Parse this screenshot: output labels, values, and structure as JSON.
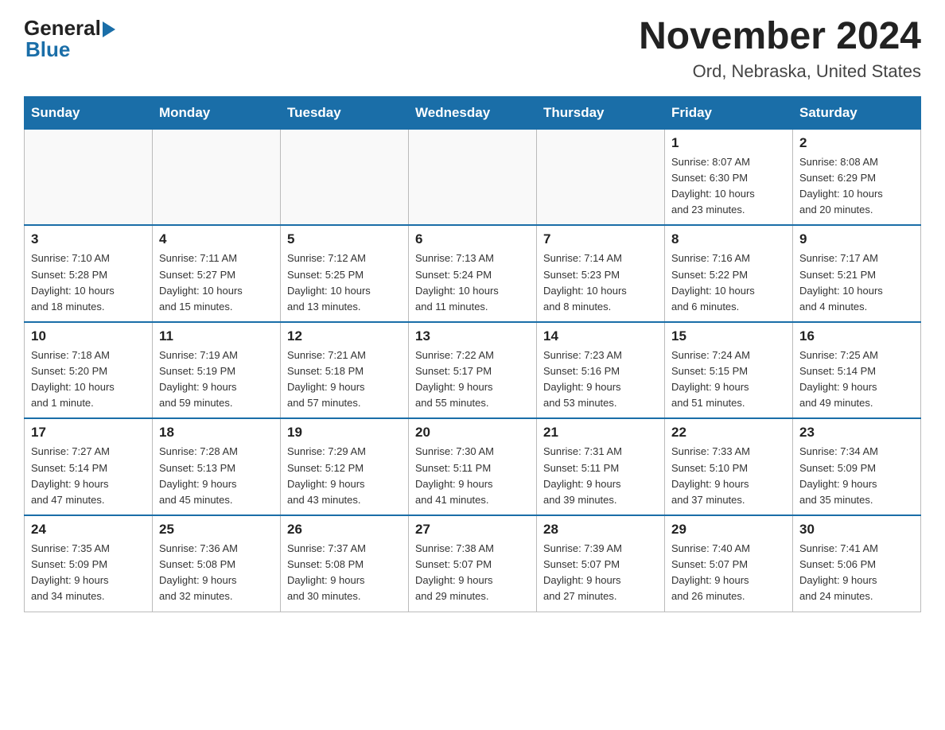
{
  "header": {
    "logo_general": "General",
    "logo_blue": "Blue",
    "month": "November 2024",
    "location": "Ord, Nebraska, United States"
  },
  "weekdays": [
    "Sunday",
    "Monday",
    "Tuesday",
    "Wednesday",
    "Thursday",
    "Friday",
    "Saturday"
  ],
  "weeks": [
    {
      "days": [
        {
          "num": "",
          "info": ""
        },
        {
          "num": "",
          "info": ""
        },
        {
          "num": "",
          "info": ""
        },
        {
          "num": "",
          "info": ""
        },
        {
          "num": "",
          "info": ""
        },
        {
          "num": "1",
          "info": "Sunrise: 8:07 AM\nSunset: 6:30 PM\nDaylight: 10 hours\nand 23 minutes."
        },
        {
          "num": "2",
          "info": "Sunrise: 8:08 AM\nSunset: 6:29 PM\nDaylight: 10 hours\nand 20 minutes."
        }
      ]
    },
    {
      "days": [
        {
          "num": "3",
          "info": "Sunrise: 7:10 AM\nSunset: 5:28 PM\nDaylight: 10 hours\nand 18 minutes."
        },
        {
          "num": "4",
          "info": "Sunrise: 7:11 AM\nSunset: 5:27 PM\nDaylight: 10 hours\nand 15 minutes."
        },
        {
          "num": "5",
          "info": "Sunrise: 7:12 AM\nSunset: 5:25 PM\nDaylight: 10 hours\nand 13 minutes."
        },
        {
          "num": "6",
          "info": "Sunrise: 7:13 AM\nSunset: 5:24 PM\nDaylight: 10 hours\nand 11 minutes."
        },
        {
          "num": "7",
          "info": "Sunrise: 7:14 AM\nSunset: 5:23 PM\nDaylight: 10 hours\nand 8 minutes."
        },
        {
          "num": "8",
          "info": "Sunrise: 7:16 AM\nSunset: 5:22 PM\nDaylight: 10 hours\nand 6 minutes."
        },
        {
          "num": "9",
          "info": "Sunrise: 7:17 AM\nSunset: 5:21 PM\nDaylight: 10 hours\nand 4 minutes."
        }
      ]
    },
    {
      "days": [
        {
          "num": "10",
          "info": "Sunrise: 7:18 AM\nSunset: 5:20 PM\nDaylight: 10 hours\nand 1 minute."
        },
        {
          "num": "11",
          "info": "Sunrise: 7:19 AM\nSunset: 5:19 PM\nDaylight: 9 hours\nand 59 minutes."
        },
        {
          "num": "12",
          "info": "Sunrise: 7:21 AM\nSunset: 5:18 PM\nDaylight: 9 hours\nand 57 minutes."
        },
        {
          "num": "13",
          "info": "Sunrise: 7:22 AM\nSunset: 5:17 PM\nDaylight: 9 hours\nand 55 minutes."
        },
        {
          "num": "14",
          "info": "Sunrise: 7:23 AM\nSunset: 5:16 PM\nDaylight: 9 hours\nand 53 minutes."
        },
        {
          "num": "15",
          "info": "Sunrise: 7:24 AM\nSunset: 5:15 PM\nDaylight: 9 hours\nand 51 minutes."
        },
        {
          "num": "16",
          "info": "Sunrise: 7:25 AM\nSunset: 5:14 PM\nDaylight: 9 hours\nand 49 minutes."
        }
      ]
    },
    {
      "days": [
        {
          "num": "17",
          "info": "Sunrise: 7:27 AM\nSunset: 5:14 PM\nDaylight: 9 hours\nand 47 minutes."
        },
        {
          "num": "18",
          "info": "Sunrise: 7:28 AM\nSunset: 5:13 PM\nDaylight: 9 hours\nand 45 minutes."
        },
        {
          "num": "19",
          "info": "Sunrise: 7:29 AM\nSunset: 5:12 PM\nDaylight: 9 hours\nand 43 minutes."
        },
        {
          "num": "20",
          "info": "Sunrise: 7:30 AM\nSunset: 5:11 PM\nDaylight: 9 hours\nand 41 minutes."
        },
        {
          "num": "21",
          "info": "Sunrise: 7:31 AM\nSunset: 5:11 PM\nDaylight: 9 hours\nand 39 minutes."
        },
        {
          "num": "22",
          "info": "Sunrise: 7:33 AM\nSunset: 5:10 PM\nDaylight: 9 hours\nand 37 minutes."
        },
        {
          "num": "23",
          "info": "Sunrise: 7:34 AM\nSunset: 5:09 PM\nDaylight: 9 hours\nand 35 minutes."
        }
      ]
    },
    {
      "days": [
        {
          "num": "24",
          "info": "Sunrise: 7:35 AM\nSunset: 5:09 PM\nDaylight: 9 hours\nand 34 minutes."
        },
        {
          "num": "25",
          "info": "Sunrise: 7:36 AM\nSunset: 5:08 PM\nDaylight: 9 hours\nand 32 minutes."
        },
        {
          "num": "26",
          "info": "Sunrise: 7:37 AM\nSunset: 5:08 PM\nDaylight: 9 hours\nand 30 minutes."
        },
        {
          "num": "27",
          "info": "Sunrise: 7:38 AM\nSunset: 5:07 PM\nDaylight: 9 hours\nand 29 minutes."
        },
        {
          "num": "28",
          "info": "Sunrise: 7:39 AM\nSunset: 5:07 PM\nDaylight: 9 hours\nand 27 minutes."
        },
        {
          "num": "29",
          "info": "Sunrise: 7:40 AM\nSunset: 5:07 PM\nDaylight: 9 hours\nand 26 minutes."
        },
        {
          "num": "30",
          "info": "Sunrise: 7:41 AM\nSunset: 5:06 PM\nDaylight: 9 hours\nand 24 minutes."
        }
      ]
    }
  ]
}
